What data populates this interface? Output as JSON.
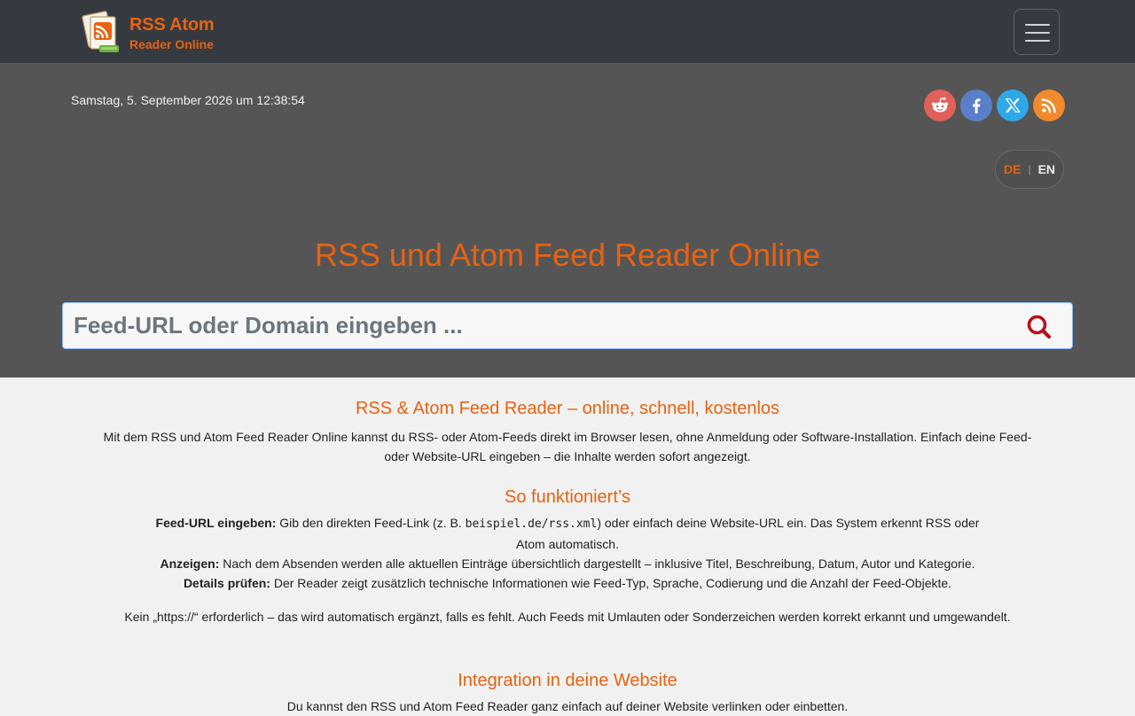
{
  "header": {
    "logo_line1": "RSS Atom",
    "logo_line2": "Reader Online",
    "menu_toggle_icon": "hamburger-menu-icon"
  },
  "hero": {
    "datetime": "Samstag, 5. September 2026 um 12:38:54",
    "social": [
      {
        "name": "reddit-icon",
        "color": "#e0605a"
      },
      {
        "name": "facebook-icon",
        "color": "#5a7fc9"
      },
      {
        "name": "x-icon",
        "color": "#2ea8e6"
      },
      {
        "name": "rss-icon",
        "color": "#f08a2c"
      }
    ],
    "lang_de": "DE",
    "lang_sep": "|",
    "lang_en": "EN",
    "title": "RSS und Atom Feed Reader Online",
    "search_placeholder": "Feed-URL oder Domain eingeben ..."
  },
  "content": {
    "intro_heading": "RSS & Atom Feed Reader – online, schnell, kostenlos",
    "intro_line1": "Mit dem RSS und Atom Feed Reader Online kannst du RSS- oder Atom-Feeds direkt im Browser lesen, ohne Anmeldung oder Software-Installation. Einfach deine Feed-",
    "intro_line2": "oder Website-URL eingeben – die Inhalte werden sofort angezeigt.",
    "how_heading": "So funktioniert’s",
    "step1_label": "Feed-URL eingeben:",
    "step1_text_a": " Gib den direkten Feed-Link (z. B. ",
    "step1_code": "beispiel.de/rss.xml",
    "step1_text_b": ") oder einfach deine Website-URL ein. Das System erkennt RSS oder",
    "step1_text_c": "Atom automatisch.",
    "step2_label": "Anzeigen:",
    "step2_text": " Nach dem Absenden werden alle aktuellen Einträge übersichtlich dargestellt – inklusive Titel, Beschreibung, Datum, Autor und Kategorie.",
    "step3_label": "Details prüfen:",
    "step3_text": " Der Reader zeigt zusätzlich technische Informationen wie Feed-Typ, Sprache, Codierung und die Anzahl der Feed-Objekte.",
    "note": "Kein „https://“ erforderlich – das wird automatisch ergänzt, falls es fehlt. Auch Feeds mit Umlauten oder Sonderzeichen werden korrekt erkannt und umgewandelt.",
    "integration_heading": "Integration in deine Website",
    "integration_text": "Du kannst den RSS und Atom Feed Reader ganz einfach auf deiner Website verlinken oder einbetten."
  },
  "colors": {
    "accent": "#e8620f",
    "navbar": "#343a40",
    "hero": "#555555",
    "search_icon": "#b5121b"
  }
}
